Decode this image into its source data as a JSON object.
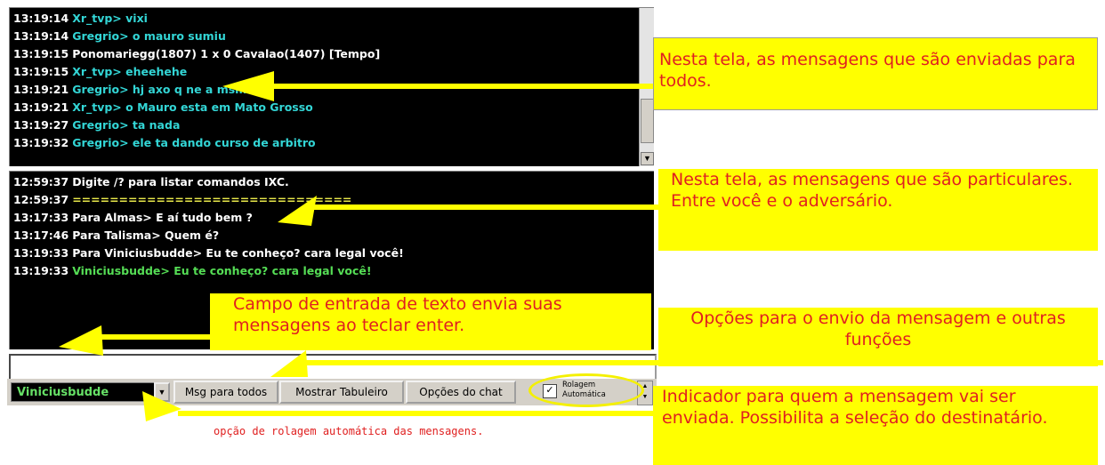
{
  "public_chat": {
    "messages": [
      {
        "time": "13:19:14",
        "text": "Xr_tvp> vixi",
        "color": "#33d6d6"
      },
      {
        "time": "13:19:14",
        "text": "Gregrio> o mauro sumiu",
        "color": "#33d6d6"
      },
      {
        "time": "13:19:15",
        "text": "Ponomariegg(1807) 1 x 0 Cavalao(1407) [Tempo]",
        "color": "#ffffff"
      },
      {
        "time": "13:19:15",
        "text": "Xr_tvp> eheehehe",
        "color": "#33d6d6"
      },
      {
        "time": "13:19:21",
        "text": "Gregrio> hj axo q ne      a msm",
        "color": "#33d6d6"
      },
      {
        "time": "13:19:21",
        "text": "Xr_tvp> o Mauro esta em Mato Grosso",
        "color": "#33d6d6"
      },
      {
        "time": "13:19:27",
        "text": "Gregrio> ta nada",
        "color": "#33d6d6"
      },
      {
        "time": "13:19:32",
        "text": "Gregrio> ele ta dando curso de arbitro",
        "color": "#33d6d6"
      }
    ]
  },
  "private_chat": {
    "messages": [
      {
        "time": "12:59:37",
        "text": "Digite /? para listar comandos IXC.",
        "color": "#ffffff"
      },
      {
        "time": "12:59:37",
        "text": "==============================",
        "color": "#e8e84a"
      },
      {
        "time": "13:17:33",
        "text": "Para Almas> E aí tudo bem ?",
        "color": "#ffffff"
      },
      {
        "time": "13:17:46",
        "text": "Para Talisma> Quem é?",
        "color": "#ffffff"
      },
      {
        "time": "13:19:33",
        "text": "Para Viniciusbudde> Eu te conheço? cara legal você!",
        "color": "#ffffff"
      },
      {
        "time": "13:19:33",
        "text": "Viniciusbudde> Eu te conheço? cara legal você!",
        "color": "#55dd55"
      }
    ]
  },
  "input": {
    "value": ""
  },
  "toolbar": {
    "recipient": "Viniciusbudde",
    "btn_msg_all": "Msg para todos",
    "btn_board": "Mostrar Tabuleiro",
    "btn_chat_options": "Opções do chat",
    "autoscroll_line1": "Rolagem",
    "autoscroll_line2": "Automática",
    "autoscroll_checked": true
  },
  "annotations": {
    "public": "Nesta tela, as mensagens que são enviadas para todos.",
    "private": "Nesta tela, as mensagens que são particulares. Entre você e o adversário.",
    "input": "Campo de entrada de texto envia suas mensagens ao teclar enter.",
    "options": "Opções para o envio da mensagem e outras funções",
    "recipient": "Indicador para quem a mensagem vai ser enviada. Possibilita a seleção do destinatário.",
    "autoscroll": "opção de rolagem automática das mensagens."
  },
  "icons": {
    "scroll_down": "chevron-down-icon",
    "dropdown": "chevron-down-icon",
    "checkbox": "checkmark-icon"
  }
}
